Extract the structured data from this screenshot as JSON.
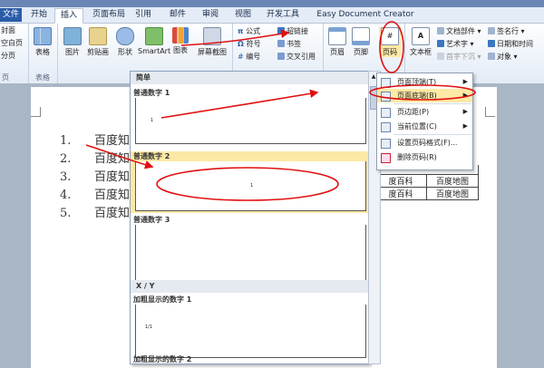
{
  "tabs": [
    "文件",
    "开始",
    "插入",
    "页面布局",
    "引用",
    "邮件",
    "审阅",
    "视图",
    "开发工具",
    "Easy Document Creator"
  ],
  "ribbon": {
    "pages_group": {
      "items": [
        "封面",
        "空白页",
        "分页"
      ],
      "label": "页"
    },
    "tables_group": {
      "button": "表格",
      "label": "表格"
    },
    "illustrations": [
      "图片",
      "剪贴画",
      "形状",
      "SmartArt",
      "图表",
      "屏幕截图"
    ],
    "links": [
      "超链接",
      "书签",
      "交叉引用"
    ],
    "formula": "公式",
    "symbol": "符号",
    "numbering": "编号",
    "header_footer": [
      "页眉",
      "页脚",
      "页码"
    ],
    "text_items": [
      "文本框",
      "文档部件",
      "艺术字",
      "首字下沉"
    ],
    "right_items": [
      "签名行",
      "日期和时间",
      "对象"
    ]
  },
  "document": {
    "list": [
      {
        "num": "1.",
        "text": "百度知"
      },
      {
        "num": "2.",
        "text": "百度知"
      },
      {
        "num": "3.",
        "text": "百度知"
      },
      {
        "num": "4.",
        "text": "百度知"
      },
      {
        "num": "5.",
        "text": "百度知"
      }
    ],
    "table": [
      [
        "度百科",
        "百度地图"
      ],
      [
        "度百科",
        "百度地图"
      ]
    ]
  },
  "gallery": {
    "header": "简单",
    "items": [
      {
        "label": "普通数字 1",
        "sample": "1"
      },
      {
        "label": "普通数字 2",
        "sample": "1"
      },
      {
        "label": "普通数字 3",
        "sample": ""
      }
    ],
    "section2": "X / Y",
    "items2": [
      {
        "label": "加粗显示的数字 1",
        "sample": "1/1"
      },
      {
        "label": "加粗显示的数字 2",
        "sample": ""
      }
    ]
  },
  "page_number_menu": {
    "items": [
      {
        "label": "页面顶端(T)",
        "submenu": true
      },
      {
        "label": "页面底端(B)",
        "submenu": true,
        "highlighted": true
      },
      {
        "label": "页边距(P)",
        "submenu": true
      },
      {
        "label": "当前位置(C)",
        "submenu": true
      },
      {
        "label": "设置页码格式(F)...",
        "submenu": false
      },
      {
        "label": "删除页码(R)",
        "submenu": false
      }
    ]
  },
  "annotation_color": "#e01010",
  "highlight_color": "#fde9a6"
}
